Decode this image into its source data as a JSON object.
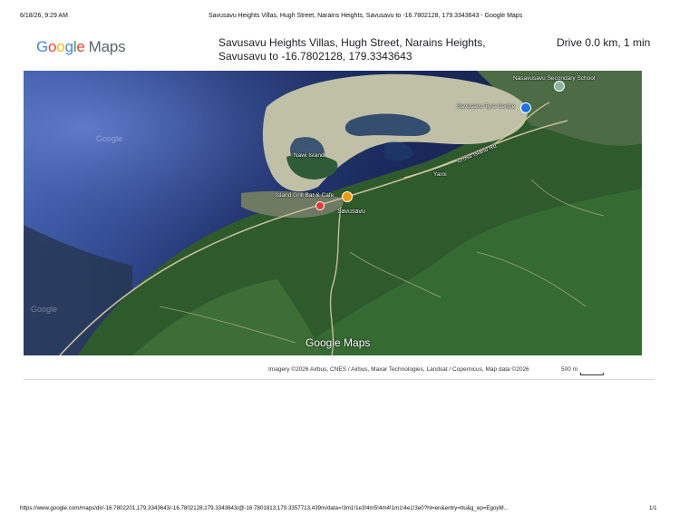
{
  "print_header": {
    "datetime": "6/18/26, 9:29 AM",
    "doc_title": "Savusavu Heights Villas, Hugh Street, Narains Heights, Savusavu to -16.7802128, 179.3343643 - Google Maps"
  },
  "logo": {
    "g1": "G",
    "g2": "o",
    "g3": "o",
    "g4": "g",
    "g5": "l",
    "g6": "e",
    "maps": "Maps"
  },
  "route": {
    "title": "Savusavu Heights Villas, Hugh Street, Narains Heights, Savusavu to -16.7802128, 179.3343643",
    "drive": "Drive 0.0 km, 1 min"
  },
  "map": {
    "labels": {
      "school": "Nasavusavu Secondary School",
      "tyre": "Savusavu Tyre Centre",
      "nawi": "Nawi Island",
      "cafe": "Island Grill Bar & Cafe",
      "town": "Savusavu",
      "road": "Cross Island Rd",
      "yaroi": "Yaroi",
      "watermark": "Google Maps",
      "ghost1": "Google",
      "ghost2": "Google"
    }
  },
  "attribution": {
    "text": "Imagery ©2026 Airbus, CNES / Airbus, Maxar Technologies, Landsat / Copernicus, Map data ©2026",
    "scale": "500 m"
  },
  "print_footer": {
    "url": "https://www.google.com/maps/dir/-16.7802201,179.3343643/-16.7802128,179.3343643/@-16.7801813,179.3357713,439m/data=!3m1!1e3!4m5!4m4!1m1!4e1!3e0?hl=en&entry=ttu&g_ep=EgoyM...",
    "page": "1/1"
  },
  "colors": {
    "ocean": "#1b2a5a",
    "land": "#2f5f2e",
    "reef": "#c7c8b0",
    "pin": "#e53935",
    "cafe_marker": "#f29900",
    "tyre_marker": "#1a73e8"
  }
}
